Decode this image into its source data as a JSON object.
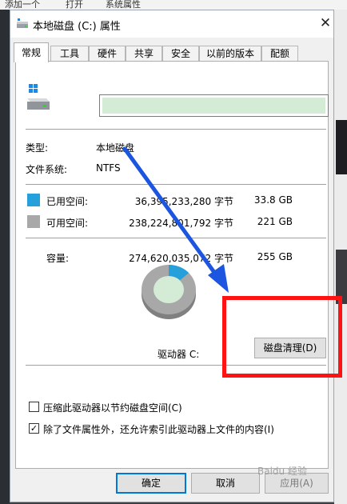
{
  "background": {
    "top_items": [
      "添加一个",
      "打开",
      "系统属性"
    ]
  },
  "window": {
    "title": "本地磁盘 (C:) 属性",
    "close_glyph": "✕"
  },
  "tabs": [
    {
      "label": "常规",
      "active": true
    },
    {
      "label": "工具",
      "active": false
    },
    {
      "label": "硬件",
      "active": false
    },
    {
      "label": "共享",
      "active": false
    },
    {
      "label": "安全",
      "active": false
    },
    {
      "label": "以前的版本",
      "active": false
    },
    {
      "label": "配额",
      "active": false
    }
  ],
  "general": {
    "drive_name_value": "",
    "type_label": "类型:",
    "type_value": "本地磁盘",
    "fs_label": "文件系统:",
    "fs_value": "NTFS",
    "used_label": "已用空间:",
    "used_bytes": "36,395,233,280 字节",
    "used_size": "33.8 GB",
    "free_label": "可用空间:",
    "free_bytes": "238,224,801,792 字节",
    "free_size": "221 GB",
    "capacity_label": "容量:",
    "capacity_bytes": "274,620,035,072 字节",
    "capacity_size": "255 GB",
    "drive_label": "驱动器 C:",
    "cleanup_button": "磁盘清理(D)",
    "used_fraction": 0.1325,
    "used_color": "#26a0da",
    "free_color": "#a8a8a8",
    "compress_label": "压缩此驱动器以节约磁盘空间(C)",
    "compress_checked": false,
    "index_label": "除了文件属性外，还允许索引此驱动器上文件的内容(I)",
    "index_checked": true
  },
  "footer": {
    "ok": "确定",
    "cancel": "取消",
    "apply": "应用(A)"
  },
  "watermark": "Baidu 经验"
}
